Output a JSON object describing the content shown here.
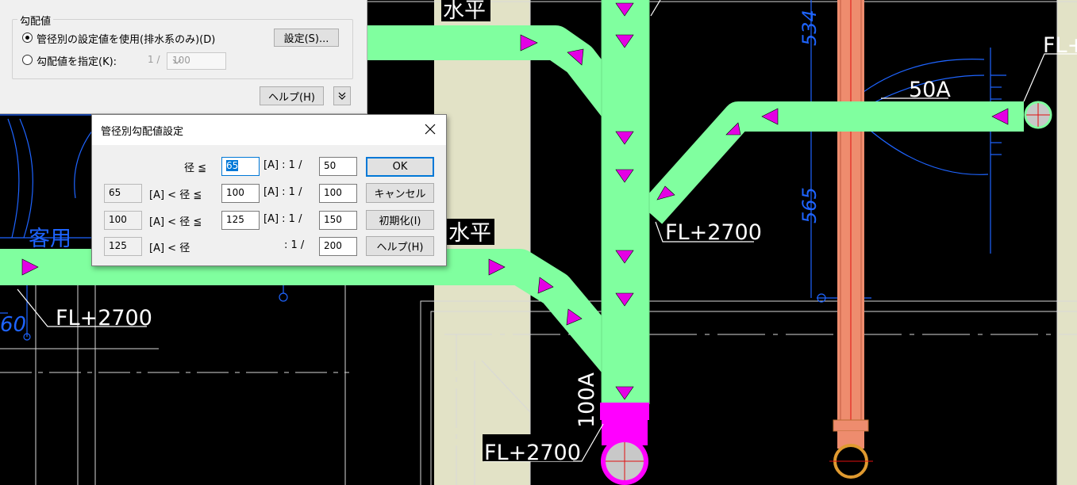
{
  "cad": {
    "labels": {
      "suihei_top": "水平",
      "suihei_mid": "水平",
      "fl_right": "FL+2700",
      "fl_left": "FL+2700",
      "fl_bottom": "FL+2700",
      "fl_topright": "FL+",
      "pipe_50a": "50A",
      "pipe_100a": "100A",
      "dim_534": "534",
      "dim_565": "565",
      "dim_60": "60",
      "room_kyaku": "客用"
    },
    "colors": {
      "pipe_green": "#80ff9f",
      "arrow_magenta": "#e400e4",
      "wall_beige": "#e2e2c6",
      "riser_orange": "#ee8c6e",
      "blue_lines": "#1e64ff"
    }
  },
  "slope_panel": {
    "group_title": "勾配値",
    "option_diameter": "管径別の設定値を使用(排水系のみ)(D)",
    "settings_button": "設定(S)...",
    "option_specify": "勾配値を指定(K):",
    "ratio_prefix": "1 /",
    "ratio_value": "100",
    "help_button": "ヘルプ(H)",
    "expand_icon": "double-chevron-down-icon"
  },
  "dialog": {
    "title": "管径別勾配値設定",
    "rows": [
      {
        "lower": "",
        "lower_op": "",
        "label": "径 ≦",
        "upper": "65",
        "ratio_label": "[A] : 1 /",
        "ratio": "50"
      },
      {
        "lower": "65",
        "lower_op": "[A] < 径 ≦",
        "label": "",
        "upper": "100",
        "ratio_label": "[A] : 1 /",
        "ratio": "100"
      },
      {
        "lower": "100",
        "lower_op": "[A] < 径 ≦",
        "label": "",
        "upper": "125",
        "ratio_label": "[A] : 1 /",
        "ratio": "150"
      },
      {
        "lower": "125",
        "lower_op": "[A] < 径",
        "label": "",
        "upper": "",
        "ratio_label": ": 1 /",
        "ratio": "200"
      }
    ],
    "ok": "OK",
    "cancel": "キャンセル",
    "reset": "初期化(I)",
    "help": "ヘルプ(H)"
  }
}
